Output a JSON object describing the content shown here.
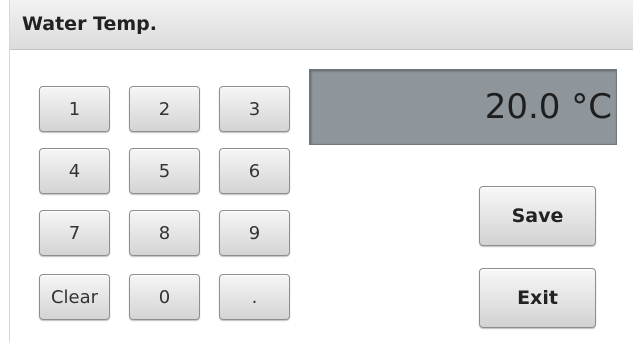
{
  "title": "Water Temp.",
  "display": {
    "value": "20.0 °C"
  },
  "keypad": {
    "k1": "1",
    "k2": "2",
    "k3": "3",
    "k4": "4",
    "k5": "5",
    "k6": "6",
    "k7": "7",
    "k8": "8",
    "k9": "9",
    "clear": "Clear",
    "k0": "0",
    "dot": "."
  },
  "actions": {
    "save": "Save",
    "exit": "Exit"
  }
}
